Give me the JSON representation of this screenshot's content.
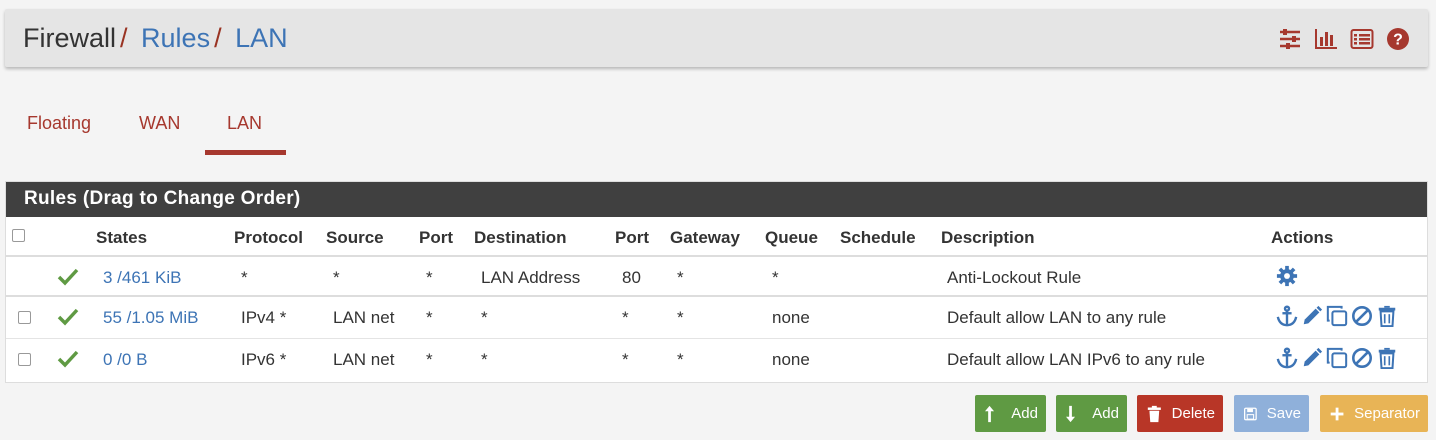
{
  "breadcrumb": {
    "root": "Firewall",
    "sep": "/",
    "level1": "Rules",
    "level2": "LAN"
  },
  "header_icons": [
    "sliders-icon",
    "bar-chart-icon",
    "list-icon",
    "help-icon"
  ],
  "tabs": [
    {
      "label": "Floating",
      "active": false
    },
    {
      "label": "WAN",
      "active": false
    },
    {
      "label": "LAN",
      "active": true
    }
  ],
  "panel": {
    "title": "Rules (Drag to Change Order)",
    "columns": [
      "States",
      "Protocol",
      "Source",
      "Port",
      "Destination",
      "Port",
      "Gateway",
      "Queue",
      "Schedule",
      "Description",
      "Actions"
    ],
    "rows": [
      {
        "checkbox": false,
        "enabled": true,
        "states": "3 /461 KiB",
        "protocol": "*",
        "source": "*",
        "port": "*",
        "destination": "LAN Address",
        "dport": "80",
        "gateway": "*",
        "queue": "*",
        "schedule": "",
        "description": "Anti-Lockout Rule",
        "actions": [
          "gear-icon"
        ]
      },
      {
        "checkbox": true,
        "enabled": true,
        "states": "55 /1.05 MiB",
        "protocol": "IPv4 *",
        "source": "LAN net",
        "port": "*",
        "destination": "*",
        "dport": "*",
        "gateway": "*",
        "queue": "none",
        "schedule": "",
        "description": "Default allow LAN to any rule",
        "actions": [
          "anchor-icon",
          "pencil-icon",
          "copy-icon",
          "ban-icon",
          "trash-icon"
        ]
      },
      {
        "checkbox": true,
        "enabled": true,
        "states": "0 /0 B",
        "protocol": "IPv6 *",
        "source": "LAN net",
        "port": "*",
        "destination": "*",
        "dport": "*",
        "gateway": "*",
        "queue": "none",
        "schedule": "",
        "description": "Default allow LAN IPv6 to any rule",
        "actions": [
          "anchor-icon",
          "pencil-icon",
          "copy-icon",
          "ban-icon",
          "trash-icon"
        ]
      }
    ]
  },
  "buttons": {
    "add_top": "Add",
    "add_bottom": "Add",
    "delete": "Delete",
    "save": "Save",
    "separator": "Separator"
  },
  "colors": {
    "accent": "#a6382e",
    "link": "#3d74b5",
    "panel_header": "#404040",
    "success": "#5f9a43",
    "danger": "#b83627",
    "primary_disabled": "#8fb0da",
    "warning": "#e8b456"
  }
}
